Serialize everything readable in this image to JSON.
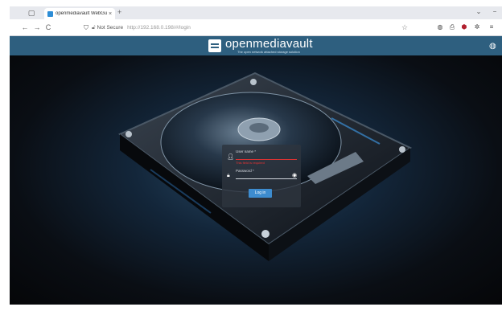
{
  "browser": {
    "tab_title": "openmediavault WebGui",
    "tab_close": "×",
    "new_tab": "+",
    "window_controls": [
      "⌄",
      "−"
    ],
    "nav": {
      "back": "←",
      "forward": "→",
      "reload": "C"
    },
    "security_label": "Not Secure",
    "url": "http://192.168.0.198/#/login"
  },
  "omv": {
    "title": "openmediavault",
    "tagline": "The open network attached storage solution"
  },
  "login": {
    "username_label": "User name *",
    "username_error": "This field is required",
    "password_label": "Password *",
    "button_label": "Log in"
  },
  "colors": {
    "header": "#2e5f7f",
    "button": "#3d8ccf",
    "error": "#dd3333"
  }
}
